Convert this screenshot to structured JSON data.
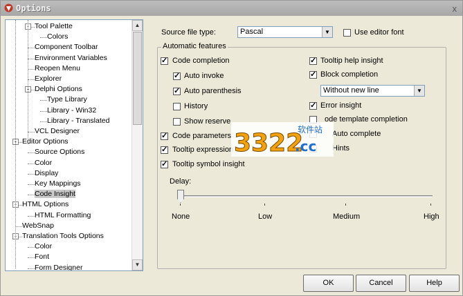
{
  "window": {
    "title": "Options",
    "close_label": "x"
  },
  "tree": {
    "items": [
      {
        "label": "Tool Palette",
        "level": 1,
        "expander": "-"
      },
      {
        "label": "Colors",
        "level": 2
      },
      {
        "label": "Component Toolbar",
        "level": 1
      },
      {
        "label": "Environment Variables",
        "level": 1
      },
      {
        "label": "Reopen Menu",
        "level": 1
      },
      {
        "label": "Explorer",
        "level": 1
      },
      {
        "label": "Delphi Options",
        "level": 1,
        "expander": "-"
      },
      {
        "label": "Type Library",
        "level": 2
      },
      {
        "label": "Library - Win32",
        "level": 2
      },
      {
        "label": "Library - Translated",
        "level": 2
      },
      {
        "label": "VCL Designer",
        "level": 1
      },
      {
        "label": "Editor Options",
        "level": 0,
        "expander": "-"
      },
      {
        "label": "Source Options",
        "level": 1
      },
      {
        "label": "Color",
        "level": 1
      },
      {
        "label": "Display",
        "level": 1
      },
      {
        "label": "Key Mappings",
        "level": 1
      },
      {
        "label": "Code Insight",
        "level": 1,
        "selected": true
      },
      {
        "label": "HTML Options",
        "level": 0,
        "expander": "-"
      },
      {
        "label": "HTML Formatting",
        "level": 1
      },
      {
        "label": "WebSnap",
        "level": 0
      },
      {
        "label": "Translation Tools Options",
        "level": 0,
        "expander": "-"
      },
      {
        "label": "Color",
        "level": 1
      },
      {
        "label": "Font",
        "level": 1
      },
      {
        "label": "Form Designer",
        "level": 1
      }
    ]
  },
  "source_file": {
    "label": "Source file type:",
    "value": "Pascal",
    "use_editor_font": "Use editor font",
    "use_editor_font_checked": false
  },
  "group": {
    "title": "Automatic features"
  },
  "left_options": {
    "code_completion": {
      "label": "Code completion",
      "checked": true
    },
    "auto_invoke": {
      "label": "Auto invoke",
      "checked": true
    },
    "auto_parenthesis": {
      "label": "Auto parenthesis",
      "checked": true
    },
    "history": {
      "label": "History",
      "checked": false
    },
    "show_reserved": {
      "label": "Show reserve",
      "checked": false
    },
    "code_parameters": {
      "label": "Code parameters",
      "checked": true
    },
    "tooltip_expression": {
      "label": "Tooltip expression",
      "checked": true
    },
    "tooltip_symbol": {
      "label": "Tooltip symbol insight",
      "checked": true
    }
  },
  "right_options": {
    "tooltip_help": {
      "label": "Tooltip help insight",
      "checked": true
    },
    "block_completion": {
      "label": "Block completion",
      "checked": true
    },
    "block_mode": "Without new line",
    "error_insight": {
      "label": "Error insight",
      "checked": true
    },
    "code_template": {
      "label": "ode template completion",
      "checked": false
    },
    "auto_complete": {
      "label": "Auto complete",
      "checked": false
    },
    "hints": {
      "label": "Hints",
      "checked": false
    }
  },
  "delay": {
    "label": "Delay:",
    "ticks": [
      "None",
      "Low",
      "Medium",
      "High"
    ],
    "value": 0
  },
  "buttons": {
    "ok": "OK",
    "cancel": "Cancel",
    "help": "Help"
  },
  "watermark": {
    "text": "3322.cc",
    "sub": "软件站"
  }
}
